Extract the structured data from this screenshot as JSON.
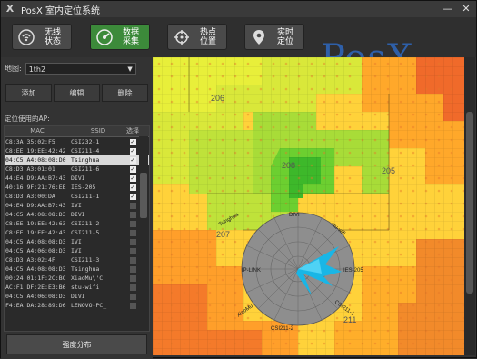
{
  "window": {
    "title": "PosX 室内定位系统",
    "minimize": "—",
    "close": "✕"
  },
  "toolbar": {
    "buttons": [
      {
        "label_line1": "无线",
        "label_line2": "状态",
        "icon": "wifi-icon"
      },
      {
        "label_line1": "数据",
        "label_line2": "采集",
        "icon": "gauge-icon",
        "active": true
      },
      {
        "label_line1": "热点",
        "label_line2": "位置",
        "icon": "crosshair-icon"
      },
      {
        "label_line1": "实时",
        "label_line2": "定位",
        "icon": "location-pin-icon"
      }
    ],
    "brand": "PosX"
  },
  "left": {
    "map_label": "地图:",
    "map_value": "1th2",
    "add_label": "添加",
    "edit_label": "编辑",
    "delete_label": "删除",
    "ap_label": "定位使用的AP:",
    "columns": [
      "MAC",
      "SSID",
      "选择"
    ],
    "rows": [
      {
        "mac": "C8:3A:35:02:F5",
        "ssid": "CSI232-1",
        "checked": true
      },
      {
        "mac": "C8:EE:19:EE:42:42",
        "ssid": "CSI211-4",
        "checked": true
      },
      {
        "mac": "04:C5:A4:08:08:D0",
        "ssid": "Tsinghua",
        "checked": true
      },
      {
        "mac": "C8:D3:A3:01:01",
        "ssid": "CSI211-6",
        "checked": true
      },
      {
        "mac": "44:E4:D9:AA:B7:43",
        "ssid": "DIVI",
        "checked": true
      },
      {
        "mac": "40:16:9F:21:76:EE",
        "ssid": "IES-205",
        "checked": true
      },
      {
        "mac": "C8:D3:A3:00:DA",
        "ssid": "CSI211-1",
        "checked": true
      },
      {
        "mac": "04:E4:D9:AA:B7:43",
        "ssid": "IVI",
        "checked": false
      },
      {
        "mac": "04:C5:A4:08:08:D3",
        "ssid": "DIVI",
        "checked": false
      },
      {
        "mac": "C8:EE:19:EE:42:63",
        "ssid": "CSI211-2",
        "checked": false
      },
      {
        "mac": "C8:EE:19:EE:42:43",
        "ssid": "CSI211-5",
        "checked": false
      },
      {
        "mac": "04:C5:A4:08:08:D3",
        "ssid": "IVI",
        "checked": false
      },
      {
        "mac": "04:C5:A4:06:08:D3",
        "ssid": "IVI",
        "checked": false
      },
      {
        "mac": "C8:D3:A3:02:4F",
        "ssid": "CSI211-3",
        "checked": false
      },
      {
        "mac": "04:C5:A4:08:08:D3",
        "ssid": "Tsinghua",
        "checked": false
      },
      {
        "mac": "00:24:01:1F:2C:BC",
        "ssid": "XiaoMu\\'C",
        "checked": false
      },
      {
        "mac": "AC:F1:DF:2E:E3:B6",
        "ssid": "stu-wifi",
        "checked": false
      },
      {
        "mac": "04:C5:A4:06:08:D3",
        "ssid": "DIVI",
        "checked": false
      },
      {
        "mac": "F4:EA:DA:28:89:D6",
        "ssid": "LENOVO-PC_",
        "checked": false
      }
    ],
    "distribution_label": "强度分布"
  },
  "map": {
    "room_labels": [
      "206",
      "208",
      "205",
      "207",
      "211"
    ],
    "radar_labels": [
      "IES-205",
      "IP-LINK",
      "Tsinghua",
      "DIVI",
      "stu-wifi",
      "CSI211-1",
      "XiaoMu",
      "CSI211-2"
    ]
  },
  "colors": {
    "accent_green": "#3c8a3a",
    "brand_blue": "#2e5fa8",
    "radar_gray": "#8e8e8e",
    "radar_cyan": "#19b6e6"
  }
}
